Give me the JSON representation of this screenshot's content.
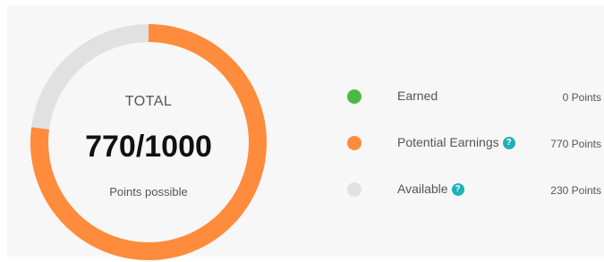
{
  "summary": {
    "total_label": "TOTAL",
    "total_value": "770/1000",
    "caption": "Points possible",
    "potential": 770,
    "max": 1000
  },
  "colors": {
    "earned": "#4cb944",
    "potential": "#ff8c3c",
    "available": "#e1e1e1",
    "help": "#1fb0b8"
  },
  "legend": [
    {
      "label": "Earned",
      "value": "0 Points",
      "color": "#4cb944",
      "help": false
    },
    {
      "label": "Potential Earnings",
      "value": "770 Points",
      "color": "#ff8c3c",
      "help": true,
      "help_icon": "question-icon",
      "help_glyph": "?"
    },
    {
      "label": "Available",
      "value": "230 Points",
      "color": "#e1e1e1",
      "help": true,
      "help_icon": "question-icon",
      "help_glyph": "?"
    }
  ]
}
